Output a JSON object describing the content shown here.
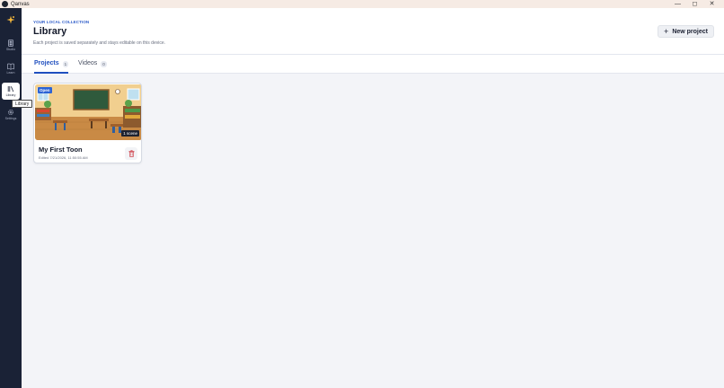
{
  "window": {
    "title": "Qanvas",
    "controls": {
      "minimize": "—",
      "maximize": "◻",
      "close": "✕"
    }
  },
  "sidebar": {
    "items": [
      {
        "label": "Studio",
        "icon": "film-icon"
      },
      {
        "label": "Learn",
        "icon": "book-icon"
      },
      {
        "label": "Library",
        "icon": "library-icon",
        "active": true
      },
      {
        "label": "Settings",
        "icon": "gear-icon"
      }
    ],
    "tooltip": "Library"
  },
  "header": {
    "eyebrow": "YOUR LOCAL COLLECTION",
    "title": "Library",
    "subtitle": "Each project is saved separately and stays editable on this device.",
    "new_button": {
      "icon": "+",
      "label": "New project"
    }
  },
  "tabs": [
    {
      "label": "Projects",
      "count": "1",
      "active": true
    },
    {
      "label": "Videos",
      "count": "0",
      "active": false
    }
  ],
  "projects": [
    {
      "title": "My First Toon",
      "edited": "Edited 7/21/2026, 11:50:55 AM",
      "badge": "Open",
      "scenes": "1 scene"
    }
  ],
  "colors": {
    "accent": "#2c63d4",
    "sidebar_bg": "#1a2236",
    "titlebar_bg": "#f6ebe4",
    "delete_icon": "#d0474f"
  }
}
